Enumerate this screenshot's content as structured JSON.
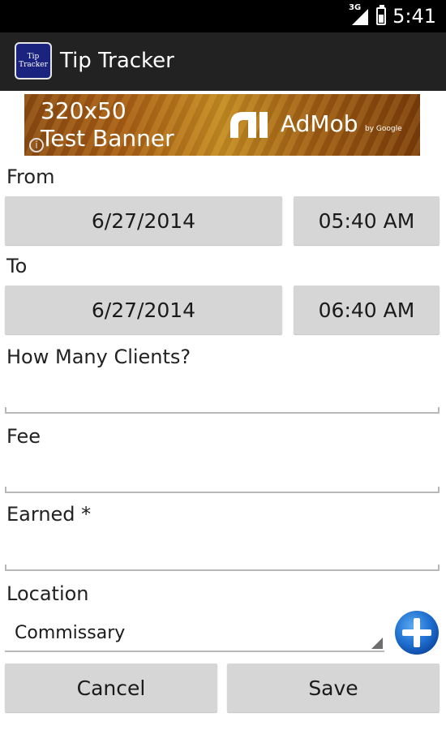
{
  "status_bar": {
    "network": "3G",
    "time": "5:41"
  },
  "app": {
    "logo_text_line1": "Tip",
    "logo_text_line2": "Tracker",
    "title": "Tip Tracker"
  },
  "ad": {
    "line1": "320x50",
    "line2": "Test Banner",
    "brand": "AdMob",
    "brand_sub": "by Google",
    "info_icon": "i"
  },
  "form": {
    "from_label": "From",
    "from_date": "6/27/2014",
    "from_time": "05:40 AM",
    "to_label": "To",
    "to_date": "6/27/2014",
    "to_time": "06:40 AM",
    "clients_label": "How Many Clients?",
    "clients_value": "",
    "fee_label": "Fee",
    "fee_value": "",
    "earned_label": "Earned *",
    "earned_value": "",
    "location_label": "Location",
    "location_value": "Commissary"
  },
  "actions": {
    "cancel": "Cancel",
    "save": "Save"
  },
  "icons": {
    "add_location": "plus-circle-icon",
    "app_logo": "tip-tracker-logo"
  },
  "colors": {
    "action_bar": "#222222",
    "button": "#d6d6d6",
    "add_button": "#1565c0"
  }
}
